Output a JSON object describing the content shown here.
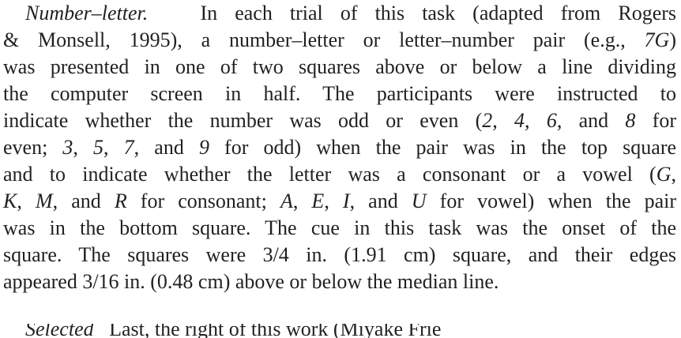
{
  "paragraph": {
    "heading": "Number–letter.",
    "lines": [
      {
        "pre": "",
        "it1": "",
        "mid": "In each trial of this task (adapted from Rogers",
        "it2": "",
        "post": ""
      },
      {
        "pre": "& Monsell, 1995), a number–letter or letter–number pair (e.g., ",
        "it1": "7G",
        "mid": ")",
        "it2": "",
        "post": ""
      },
      {
        "pre": "was presented in one of two squares above or below a line dividing",
        "it1": "",
        "mid": "",
        "it2": "",
        "post": ""
      },
      {
        "pre": "the computer screen in half. The participants were instructed to",
        "it1": "",
        "mid": "",
        "it2": "",
        "post": ""
      },
      {
        "pre": "indicate whether the number was odd or even (",
        "it1": "2",
        "mid": ", ",
        "it2": "4",
        "post": ""
      },
      {
        "pre": "even; ",
        "it1": "3",
        "mid": ", ",
        "it2": "5",
        "post": ""
      },
      {
        "pre": "and to indicate whether the letter was a consonant or a vowel (",
        "it1": "G",
        "mid": ",",
        "it2": "",
        "post": ""
      },
      {
        "pre": "",
        "it1": "K",
        "mid": ", ",
        "it2": "M",
        "post": ""
      },
      {
        "pre": "was in the bottom square. The cue in this task was the onset of the",
        "it1": "",
        "mid": "",
        "it2": "",
        "post": ""
      },
      {
        "pre": "square. The squares were 3/4 in. (1.91 cm) square, and their edges",
        "it1": "",
        "mid": "",
        "it2": "",
        "post": ""
      },
      {
        "pre": "appeared 3/16 in. (0.48 cm) above or below the median line.",
        "it1": "",
        "mid": "",
        "it2": "",
        "post": ""
      }
    ],
    "line5_rest": {
      "a": ", ",
      "b": "6",
      "c": ", and ",
      "d": "8",
      "e": " for"
    },
    "line6_rest": {
      "a": ", ",
      "b": "7",
      "c": ", and ",
      "d": "9",
      "e": " for odd) when the pair was in the top square"
    },
    "line8_rest": {
      "a": ", and ",
      "b": "R",
      "c": " for consonant; ",
      "d": "A",
      "e": ", ",
      "f": "E",
      "g": ", ",
      "h": "I",
      "i": ", and ",
      "j": "U",
      "k": " for vowel) when the pair"
    },
    "next_heading": "Selected",
    "next_text": "Last, the right of this work (Miyake Frie"
  }
}
